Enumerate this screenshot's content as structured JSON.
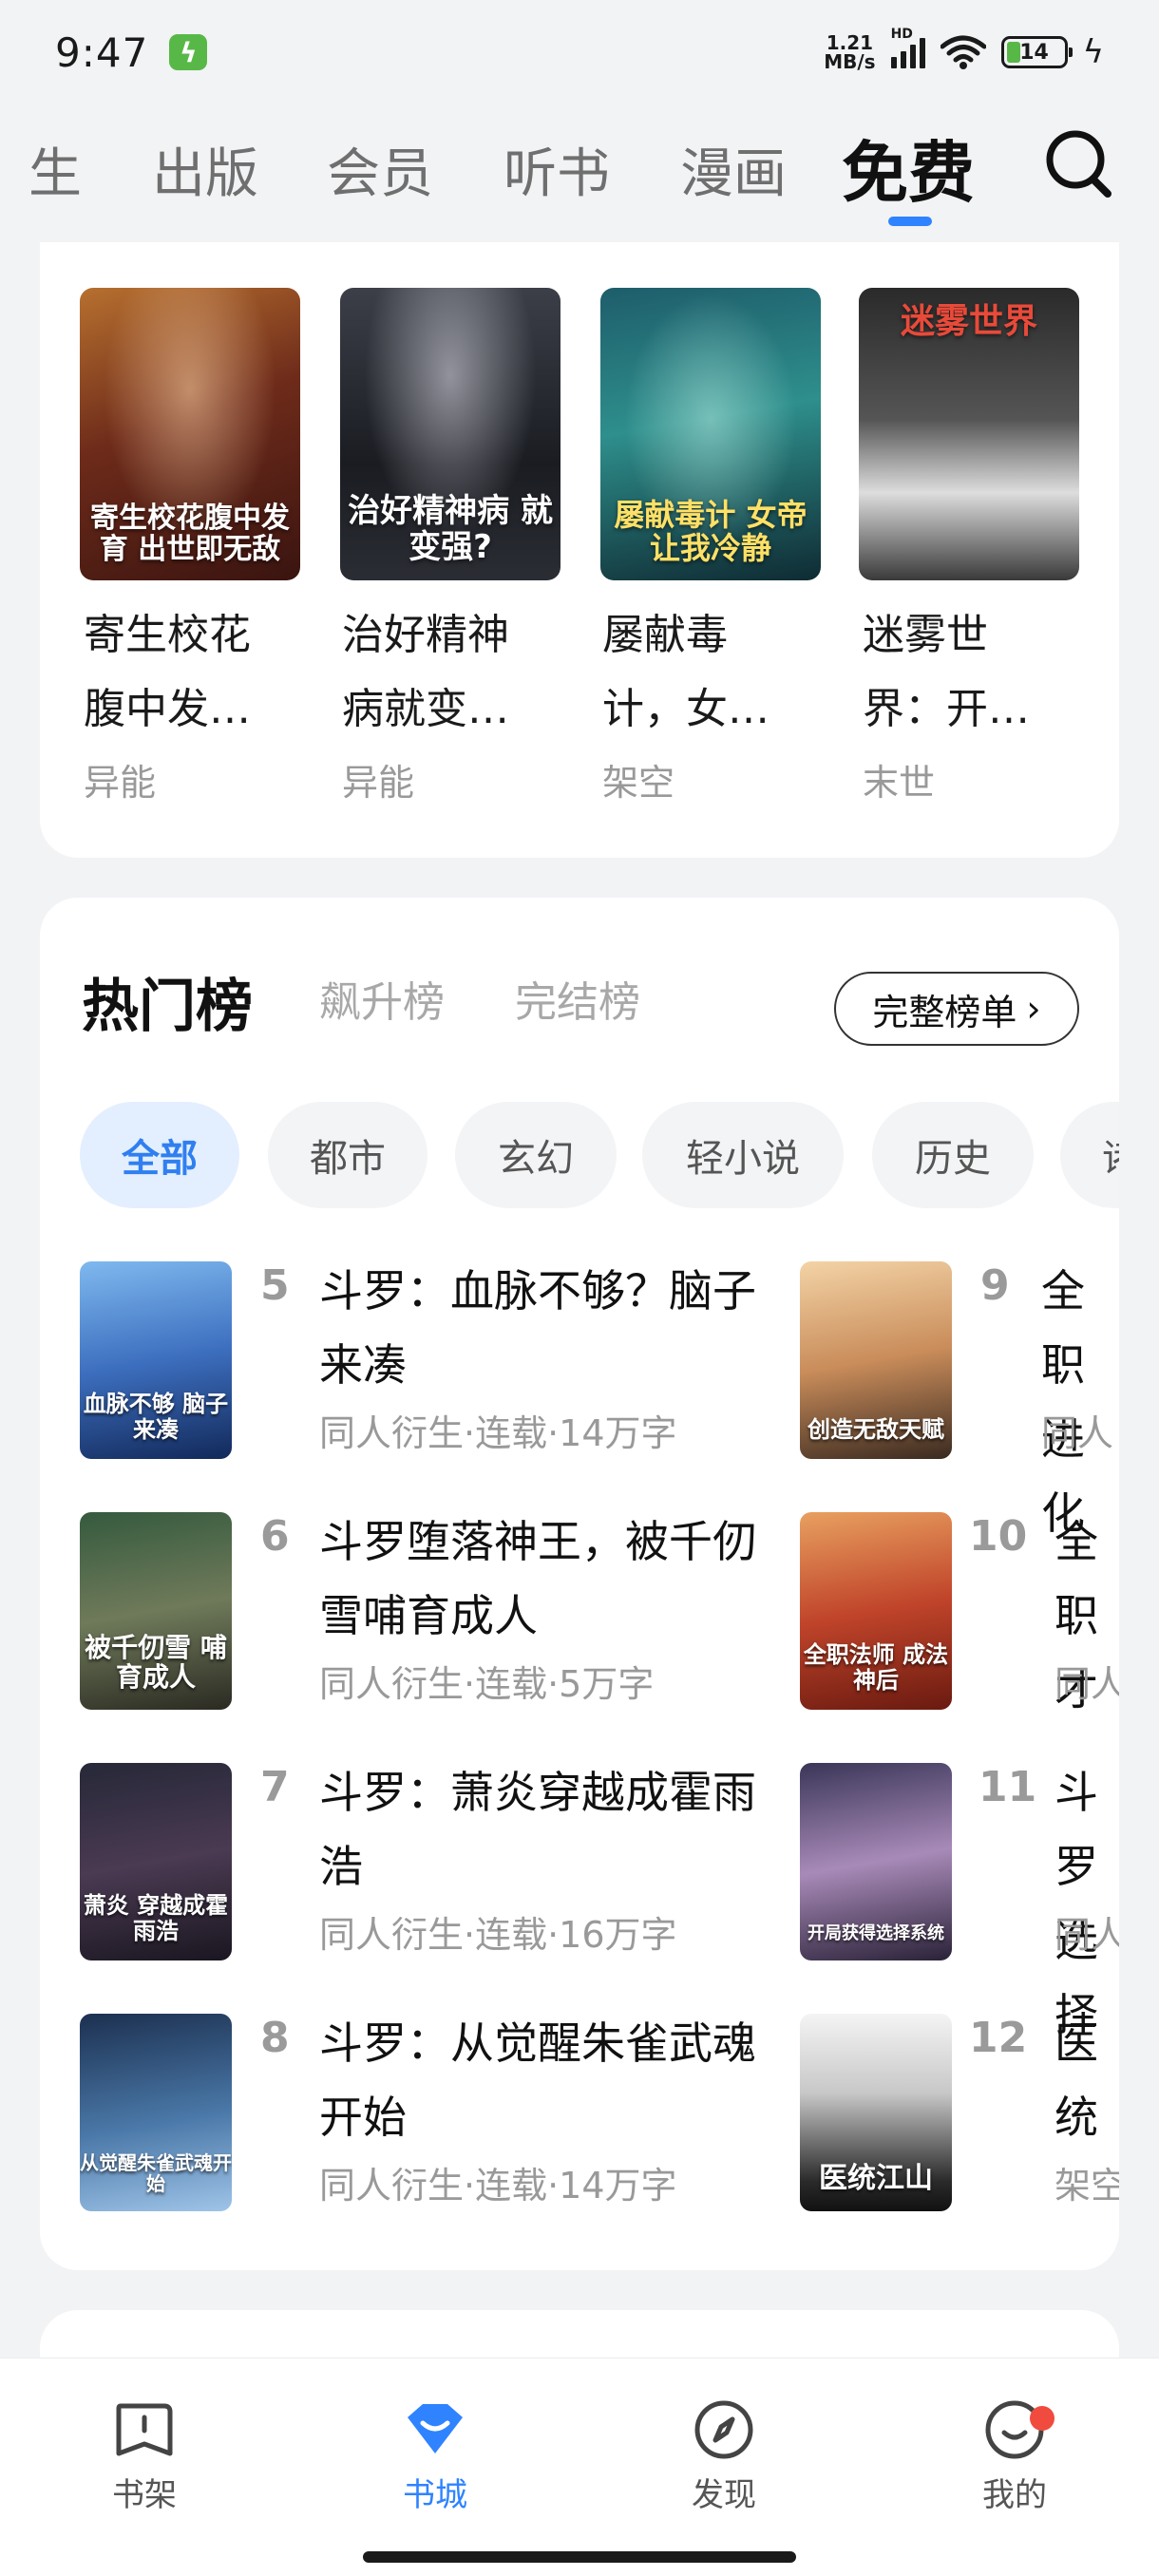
{
  "status": {
    "time": "9:47",
    "speed_top": "1.21",
    "speed_bottom": "MB/s",
    "hd": "HD",
    "battery": "14"
  },
  "nav": {
    "tabs": [
      "生",
      "出版",
      "会员",
      "听书",
      "漫画",
      "免费"
    ],
    "active": "免费"
  },
  "recommend": [
    {
      "title_line1": "寄生校花",
      "title_line2": "腹中发…",
      "genre": "异能",
      "cover_text": "寄生校花腹中发育 出世即无敌"
    },
    {
      "title_line1": "治好精神",
      "title_line2": "病就变…",
      "genre": "异能",
      "cover_text": "治好精神病 就变强?"
    },
    {
      "title_line1": "屡献毒",
      "title_line2": "计，女…",
      "genre": "架空",
      "cover_text": "屡献毒计 女帝让我冷静"
    },
    {
      "title_line1": "迷雾世",
      "title_line2": "界：开…",
      "genre": "末世",
      "cover_text": "迷雾世界"
    }
  ],
  "hot": {
    "tabs": [
      "热门榜",
      "飙升榜",
      "完结榜"
    ],
    "full_rank": "完整榜单",
    "chips": [
      "全部",
      "都市",
      "玄幻",
      "轻小说",
      "历史",
      "诸"
    ],
    "left_col": [
      {
        "rank": "5",
        "title": "斗罗：血脉不够？脑子来凑",
        "meta": "同人衍生·连载·14万字",
        "cover_text": "血脉不够 脑子来凑"
      },
      {
        "rank": "6",
        "title": "斗罗堕落神王，被千仞雪哺育成人",
        "meta": "同人衍生·连载·5万字",
        "cover_text": "被千仞雪 哺育成人"
      },
      {
        "rank": "7",
        "title": "斗罗：萧炎穿越成霍雨浩",
        "meta": "同人衍生·连载·16万字",
        "cover_text": "萧炎 穿越成霍雨浩"
      },
      {
        "rank": "8",
        "title": "斗罗：从觉醒朱雀武魂开始",
        "meta": "同人衍生·连载·14万字",
        "cover_text": "从觉醒朱雀武魂开始"
      }
    ],
    "right_col": [
      {
        "rank": "9",
        "title": "全职进化",
        "meta": "同人",
        "cover_text": "创造无敌天赋"
      },
      {
        "rank": "10",
        "title": "全职才",
        "meta": "同人",
        "cover_text": "全职法师 成法神后"
      },
      {
        "rank": "11",
        "title": "斗罗选择",
        "meta": "同人",
        "cover_text": "开局获得选择系统"
      },
      {
        "rank": "12",
        "title": "医统",
        "meta": "架空",
        "cover_text": "医统江山"
      }
    ]
  },
  "bottom_nav": [
    "书架",
    "书城",
    "发现",
    "我的"
  ]
}
